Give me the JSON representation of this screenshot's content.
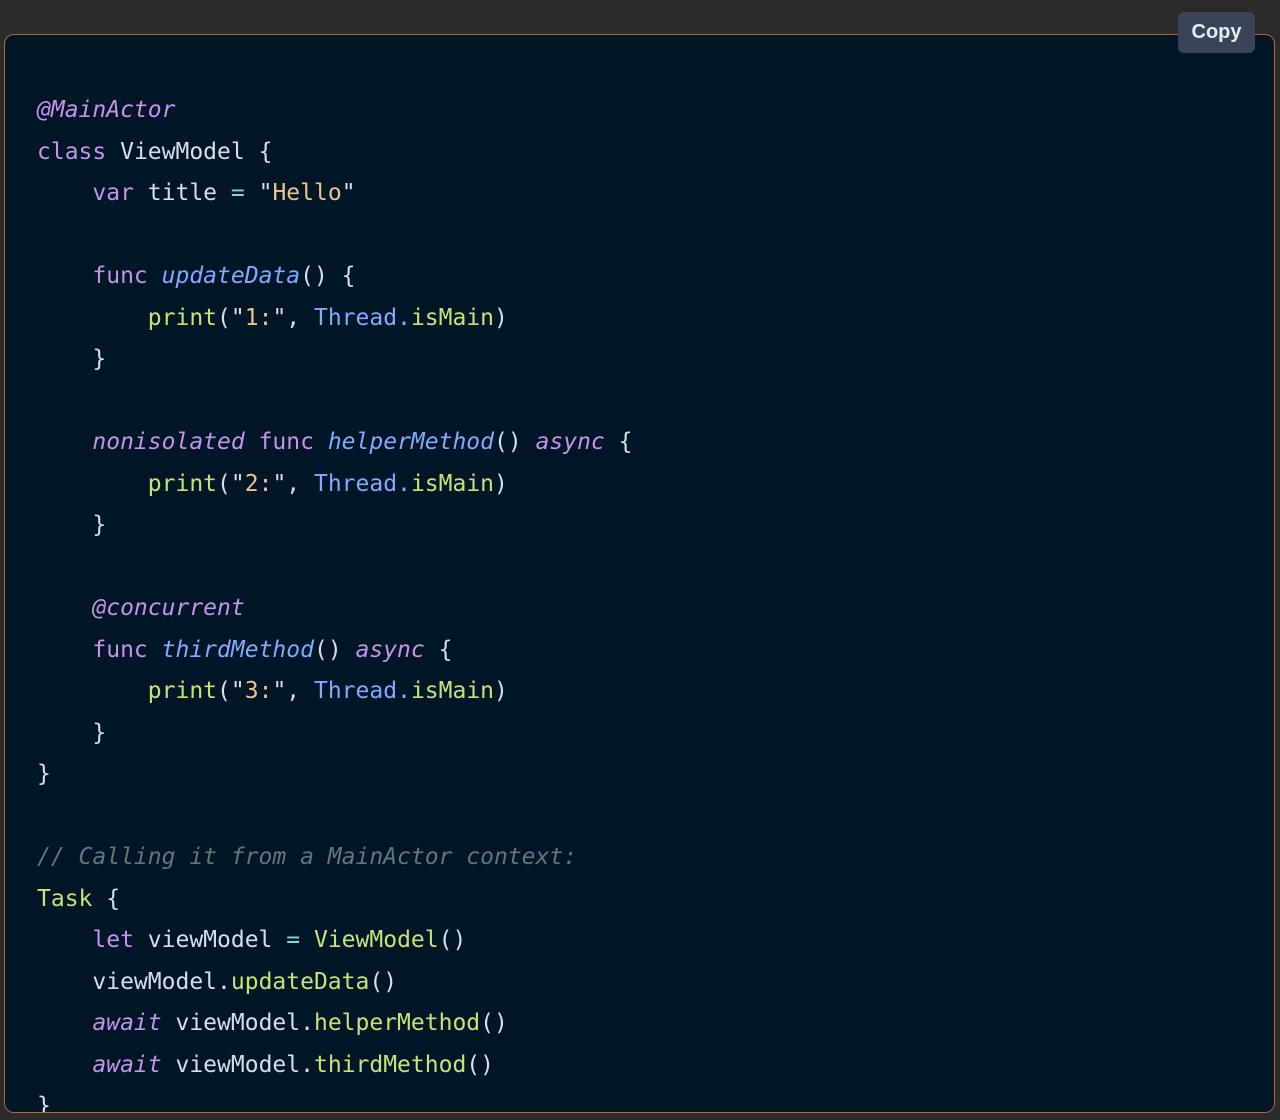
{
  "copy_button": {
    "label": "Copy"
  },
  "colors": {
    "background": "#011627",
    "border": "#b8652f",
    "page_background": "#2b2b2b",
    "button_background": "#3b4457"
  },
  "code": {
    "language": "swift",
    "lines": [
      [
        {
          "t": "@MainActor",
          "k": "kwi"
        }
      ],
      [
        {
          "t": "class",
          "k": "kw"
        },
        {
          "t": " ViewModel {",
          "k": "id"
        }
      ],
      [
        {
          "t": "    ",
          "k": "id"
        },
        {
          "t": "var",
          "k": "kw"
        },
        {
          "t": " title ",
          "k": "id"
        },
        {
          "t": "=",
          "k": "op"
        },
        {
          "t": " \"",
          "k": "punc"
        },
        {
          "t": "Hello",
          "k": "str"
        },
        {
          "t": "\"",
          "k": "punc"
        }
      ],
      [],
      [
        {
          "t": "    ",
          "k": "id"
        },
        {
          "t": "func",
          "k": "kw"
        },
        {
          "t": " ",
          "k": "id"
        },
        {
          "t": "updateData",
          "k": "fn"
        },
        {
          "t": "() {",
          "k": "punc"
        }
      ],
      [
        {
          "t": "        ",
          "k": "id"
        },
        {
          "t": "print",
          "k": "call"
        },
        {
          "t": "(\"",
          "k": "punc"
        },
        {
          "t": "1:",
          "k": "str"
        },
        {
          "t": "\", ",
          "k": "punc"
        },
        {
          "t": "Thread",
          "k": "type"
        },
        {
          "t": ".",
          "k": "type"
        },
        {
          "t": "isMain",
          "k": "call"
        },
        {
          "t": ")",
          "k": "punc"
        }
      ],
      [
        {
          "t": "    }",
          "k": "punc"
        }
      ],
      [],
      [
        {
          "t": "    ",
          "k": "id"
        },
        {
          "t": "nonisolated",
          "k": "kwi"
        },
        {
          "t": " ",
          "k": "id"
        },
        {
          "t": "func",
          "k": "kw"
        },
        {
          "t": " ",
          "k": "id"
        },
        {
          "t": "helperMethod",
          "k": "fn"
        },
        {
          "t": "() ",
          "k": "punc"
        },
        {
          "t": "async",
          "k": "kwi"
        },
        {
          "t": " {",
          "k": "punc"
        }
      ],
      [
        {
          "t": "        ",
          "k": "id"
        },
        {
          "t": "print",
          "k": "call"
        },
        {
          "t": "(\"",
          "k": "punc"
        },
        {
          "t": "2:",
          "k": "str"
        },
        {
          "t": "\", ",
          "k": "punc"
        },
        {
          "t": "Thread",
          "k": "type"
        },
        {
          "t": ".",
          "k": "type"
        },
        {
          "t": "isMain",
          "k": "call"
        },
        {
          "t": ")",
          "k": "punc"
        }
      ],
      [
        {
          "t": "    }",
          "k": "punc"
        }
      ],
      [],
      [
        {
          "t": "    ",
          "k": "id"
        },
        {
          "t": "@concurrent",
          "k": "kwi"
        }
      ],
      [
        {
          "t": "    ",
          "k": "id"
        },
        {
          "t": "func",
          "k": "kw"
        },
        {
          "t": " ",
          "k": "id"
        },
        {
          "t": "thirdMethod",
          "k": "fn"
        },
        {
          "t": "() ",
          "k": "punc"
        },
        {
          "t": "async",
          "k": "kwi"
        },
        {
          "t": " {",
          "k": "punc"
        }
      ],
      [
        {
          "t": "        ",
          "k": "id"
        },
        {
          "t": "print",
          "k": "call"
        },
        {
          "t": "(\"",
          "k": "punc"
        },
        {
          "t": "3:",
          "k": "str"
        },
        {
          "t": "\", ",
          "k": "punc"
        },
        {
          "t": "Thread",
          "k": "type"
        },
        {
          "t": ".",
          "k": "type"
        },
        {
          "t": "isMain",
          "k": "call"
        },
        {
          "t": ")",
          "k": "punc"
        }
      ],
      [
        {
          "t": "    }",
          "k": "punc"
        }
      ],
      [
        {
          "t": "}",
          "k": "punc"
        }
      ],
      [],
      [
        {
          "t": "// Calling it from a MainActor context:",
          "k": "comment"
        }
      ],
      [
        {
          "t": "Task",
          "k": "call"
        },
        {
          "t": " {",
          "k": "punc"
        }
      ],
      [
        {
          "t": "    ",
          "k": "id"
        },
        {
          "t": "let",
          "k": "kw"
        },
        {
          "t": " viewModel ",
          "k": "id"
        },
        {
          "t": "=",
          "k": "op"
        },
        {
          "t": " ",
          "k": "id"
        },
        {
          "t": "ViewModel",
          "k": "call"
        },
        {
          "t": "()",
          "k": "punc"
        }
      ],
      [
        {
          "t": "    viewModel.",
          "k": "id"
        },
        {
          "t": "updateData",
          "k": "call"
        },
        {
          "t": "()",
          "k": "punc"
        }
      ],
      [
        {
          "t": "    ",
          "k": "id"
        },
        {
          "t": "await",
          "k": "kwi"
        },
        {
          "t": " viewModel.",
          "k": "id"
        },
        {
          "t": "helperMethod",
          "k": "call"
        },
        {
          "t": "()",
          "k": "punc"
        }
      ],
      [
        {
          "t": "    ",
          "k": "id"
        },
        {
          "t": "await",
          "k": "kwi"
        },
        {
          "t": " viewModel.",
          "k": "id"
        },
        {
          "t": "thirdMethod",
          "k": "call"
        },
        {
          "t": "()",
          "k": "punc"
        }
      ],
      [
        {
          "t": "}",
          "k": "punc"
        }
      ]
    ]
  }
}
